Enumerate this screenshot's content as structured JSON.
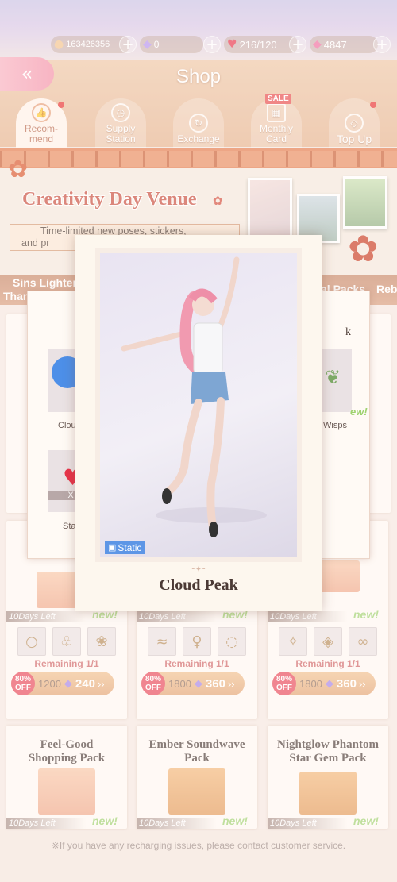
{
  "topbar": {
    "currency1": "163426356",
    "currency2": "0",
    "stamina": "216/120",
    "gems": "4847"
  },
  "header": {
    "title": "Shop"
  },
  "tabs": [
    {
      "label": "Recom-\nmend",
      "icon": "thumbs-up-icon"
    },
    {
      "label": "Supply\nStation",
      "icon": "clock-icon"
    },
    {
      "label": "Exchange",
      "icon": "exchange-icon"
    },
    {
      "label": "Monthly\nCard",
      "icon": "calendar-icon",
      "badge": "SALE"
    },
    {
      "label": "Top Up",
      "icon": "diamond-icon"
    }
  ],
  "banner": {
    "title": "Creativity Day Venue",
    "subtitle": "Time-limited new poses, stickers,",
    "subtitle2": "and pr"
  },
  "category_tabs": [
    "Sins Lighter",
    "Than a Feath",
    "al Packs",
    "Reb"
  ],
  "side_cards": {
    "left": {
      "items": [
        "Clou",
        "Sta"
      ],
      "badge": "X",
      "dl": "10D"
    },
    "right": {
      "title": "k",
      "items": [
        "Wisps"
      ],
      "new": "ew!"
    }
  },
  "packs_row1": [
    {
      "days": "10Days Left",
      "new": "new!",
      "remaining": "Remaining 1/1",
      "off": "80%\nOFF",
      "old": "1200",
      "price": "240"
    },
    {
      "days": "10Days Left",
      "new": "new!",
      "remaining": "Remaining 1/1",
      "off": "80%\nOFF",
      "old": "1800",
      "price": "360"
    },
    {
      "days": "10Days Left",
      "new": "new!",
      "remaining": "Remaining 1/1",
      "off": "80%\nOFF",
      "old": "1800",
      "price": "360"
    }
  ],
  "packs_row2": [
    {
      "title": "Feel-Good Shopping Pack",
      "days": "10Days Left",
      "new": "new!"
    },
    {
      "title": "Ember Soundwave Pack",
      "days": "10Days Left",
      "new": "new!"
    },
    {
      "title": "Nightglow Phantom Star Gem Pack",
      "days": "10Days Left",
      "new": "new!"
    }
  ],
  "popup": {
    "name": "Cloud Peak",
    "badge": "Static"
  },
  "footer": "※If you have any recharging issues, please contact customer service.",
  "colors": {
    "accent": "#e8485a",
    "new": "#9ed26e"
  }
}
